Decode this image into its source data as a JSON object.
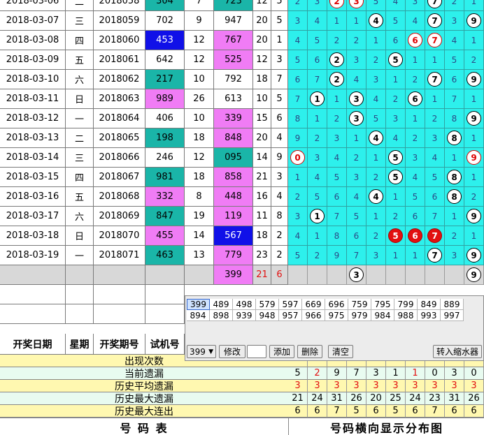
{
  "rows": [
    {
      "date": "2018-03-06",
      "weekday": "二",
      "issue": "2018058",
      "trial": "304",
      "trial_color": "teal",
      "c5": "7",
      "draw": "723",
      "draw_color": "teal",
      "c7": "12",
      "c8": "5"
    },
    {
      "date": "2018-03-07",
      "weekday": "三",
      "issue": "2018059",
      "trial": "702",
      "trial_color": "none",
      "c5": "9",
      "draw": "947",
      "draw_color": "none",
      "c7": "20",
      "c8": "5"
    },
    {
      "date": "2018-03-08",
      "weekday": "四",
      "issue": "2018060",
      "trial": "453",
      "trial_color": "blue",
      "c5": "12",
      "draw": "767",
      "draw_color": "pink",
      "c7": "20",
      "c8": "1"
    },
    {
      "date": "2018-03-09",
      "weekday": "五",
      "issue": "2018061",
      "trial": "642",
      "trial_color": "none",
      "c5": "12",
      "draw": "525",
      "draw_color": "pink",
      "c7": "12",
      "c8": "3"
    },
    {
      "date": "2018-03-10",
      "weekday": "六",
      "issue": "2018062",
      "trial": "217",
      "trial_color": "teal",
      "c5": "10",
      "draw": "792",
      "draw_color": "none",
      "c7": "18",
      "c8": "7"
    },
    {
      "date": "2018-03-11",
      "weekday": "日",
      "issue": "2018063",
      "trial": "989",
      "trial_color": "pink",
      "c5": "26",
      "draw": "613",
      "draw_color": "none",
      "c7": "10",
      "c8": "5"
    },
    {
      "date": "2018-03-12",
      "weekday": "一",
      "issue": "2018064",
      "trial": "406",
      "trial_color": "none",
      "c5": "10",
      "draw": "339",
      "draw_color": "pink",
      "c7": "15",
      "c8": "6"
    },
    {
      "date": "2018-03-13",
      "weekday": "二",
      "issue": "2018065",
      "trial": "198",
      "trial_color": "teal",
      "c5": "18",
      "draw": "848",
      "draw_color": "pink",
      "c7": "20",
      "c8": "4"
    },
    {
      "date": "2018-03-14",
      "weekday": "三",
      "issue": "2018066",
      "trial": "246",
      "trial_color": "none",
      "c5": "12",
      "draw": "095",
      "draw_color": "teal",
      "c7": "14",
      "c8": "9"
    },
    {
      "date": "2018-03-15",
      "weekday": "四",
      "issue": "2018067",
      "trial": "981",
      "trial_color": "teal",
      "c5": "18",
      "draw": "858",
      "draw_color": "pink",
      "c7": "21",
      "c8": "3"
    },
    {
      "date": "2018-03-16",
      "weekday": "五",
      "issue": "2018068",
      "trial": "332",
      "trial_color": "pink",
      "c5": "8",
      "draw": "448",
      "draw_color": "pink",
      "c7": "16",
      "c8": "4"
    },
    {
      "date": "2018-03-17",
      "weekday": "六",
      "issue": "2018069",
      "trial": "847",
      "trial_color": "teal",
      "c5": "19",
      "draw": "119",
      "draw_color": "pink",
      "c7": "11",
      "c8": "8"
    },
    {
      "date": "2018-03-18",
      "weekday": "日",
      "issue": "2018070",
      "trial": "455",
      "trial_color": "pink",
      "c5": "14",
      "draw": "567",
      "draw_color": "blue",
      "c7": "18",
      "c8": "2"
    },
    {
      "date": "2018-03-19",
      "weekday": "一",
      "issue": "2018071",
      "trial": "463",
      "trial_color": "teal",
      "c5": "13",
      "draw": "779",
      "draw_color": "pink",
      "c7": "23",
      "c8": "2"
    }
  ],
  "dist": [
    [
      "2",
      "3",
      {
        "v": "2",
        "s": "rw"
      },
      {
        "v": "3",
        "s": "rw"
      },
      "5",
      "4",
      "3",
      {
        "v": "7",
        "s": "w"
      },
      "2",
      "1"
    ],
    [
      "3",
      "4",
      "1",
      "1",
      {
        "v": "4",
        "s": "w"
      },
      "5",
      "4",
      {
        "v": "7",
        "s": "w"
      },
      "3",
      {
        "v": "9",
        "s": "w"
      }
    ],
    [
      "4",
      "5",
      "2",
      "2",
      "1",
      "6",
      {
        "v": "6",
        "s": "rw"
      },
      {
        "v": "7",
        "s": "rw"
      },
      "4",
      "1"
    ],
    [
      "5",
      "6",
      {
        "v": "2",
        "s": "w"
      },
      "3",
      "2",
      {
        "v": "5",
        "s": "w"
      },
      "1",
      "1",
      "5",
      "2"
    ],
    [
      "6",
      "7",
      {
        "v": "2",
        "s": "w"
      },
      "4",
      "3",
      "1",
      "2",
      {
        "v": "7",
        "s": "w"
      },
      "6",
      {
        "v": "9",
        "s": "w"
      }
    ],
    [
      "7",
      {
        "v": "1",
        "s": "w"
      },
      "1",
      {
        "v": "3",
        "s": "w"
      },
      "4",
      "2",
      {
        "v": "6",
        "s": "w"
      },
      "1",
      "7",
      "1"
    ],
    [
      "8",
      "1",
      "2",
      {
        "v": "3",
        "s": "w"
      },
      "5",
      "3",
      "1",
      "2",
      "8",
      {
        "v": "9",
        "s": "w"
      }
    ],
    [
      "9",
      "2",
      "3",
      "1",
      {
        "v": "4",
        "s": "w"
      },
      "4",
      "2",
      "3",
      {
        "v": "8",
        "s": "w"
      },
      "1"
    ],
    [
      {
        "v": "0",
        "s": "rw"
      },
      "3",
      "4",
      "2",
      "1",
      {
        "v": "5",
        "s": "w"
      },
      "3",
      "4",
      "1",
      {
        "v": "9",
        "s": "rw"
      }
    ],
    [
      "1",
      "4",
      "5",
      "3",
      "2",
      {
        "v": "5",
        "s": "w"
      },
      "4",
      "5",
      {
        "v": "8",
        "s": "w"
      },
      "1"
    ],
    [
      "2",
      "5",
      "6",
      "4",
      {
        "v": "4",
        "s": "w"
      },
      "1",
      "5",
      "6",
      {
        "v": "8",
        "s": "w"
      },
      "2"
    ],
    [
      "3",
      {
        "v": "1",
        "s": "w"
      },
      "7",
      "5",
      "1",
      "2",
      "6",
      "7",
      "1",
      {
        "v": "9",
        "s": "w"
      }
    ],
    [
      "4",
      "1",
      "8",
      "6",
      "2",
      {
        "v": "5",
        "s": "r"
      },
      {
        "v": "6",
        "s": "r"
      },
      {
        "v": "7",
        "s": "r"
      },
      "2",
      "1"
    ],
    [
      "5",
      "2",
      "9",
      "7",
      "3",
      "1",
      "1",
      {
        "v": "7",
        "s": "w"
      },
      "3",
      {
        "v": "9",
        "s": "w"
      }
    ]
  ],
  "extra_row": {
    "draw": "399",
    "c7": "21",
    "c8": "6",
    "balls": [
      {
        "col": 3,
        "v": "3"
      },
      {
        "col": 9,
        "v": "9"
      }
    ]
  },
  "headers": {
    "date": "开奖日期",
    "weekday": "星期",
    "issue": "开奖期号",
    "trial": "试机号"
  },
  "candidates": {
    "row1": [
      "399",
      "489",
      "498",
      "579",
      "597",
      "669",
      "696",
      "759",
      "795",
      "799",
      "849",
      "889"
    ],
    "row2": [
      "894",
      "898",
      "939",
      "948",
      "957",
      "966",
      "975",
      "979",
      "984",
      "988",
      "993",
      "997"
    ],
    "selected": "399"
  },
  "controls": {
    "select_value": "399",
    "edit": "修改",
    "add": "添加",
    "delete": "删除",
    "clear": "清空",
    "filter": "转入缩水器"
  },
  "stats": [
    {
      "label": "出现次数",
      "values": [
        "",
        "",
        "",
        "",
        "",
        "",
        "",
        "",
        "",
        ""
      ]
    },
    {
      "label": "当前遗漏",
      "values": [
        "5",
        "2",
        "9",
        "7",
        "3",
        "1",
        "1",
        "0",
        "3",
        "0"
      ],
      "red": [
        1,
        6
      ]
    },
    {
      "label": "历史平均遗漏",
      "values": [
        "3",
        "3",
        "3",
        "3",
        "3",
        "3",
        "3",
        "3",
        "3",
        "3"
      ],
      "red": [
        0,
        1,
        2,
        3,
        4,
        5,
        6,
        7,
        8,
        9
      ]
    },
    {
      "label": "历史最大遗漏",
      "values": [
        "21",
        "24",
        "31",
        "26",
        "20",
        "25",
        "24",
        "23",
        "31",
        "26"
      ]
    },
    {
      "label": "历史最大连出",
      "values": [
        "6",
        "6",
        "7",
        "5",
        "6",
        "5",
        "6",
        "7",
        "6",
        "6"
      ]
    }
  ],
  "footer": {
    "left": "号  码  表",
    "right": "号码横向显示分布图"
  },
  "colors": {
    "cyan": "#2df0ec",
    "teal": "#1ab5a8",
    "pink": "#f07cf5",
    "blue": "#1010e8",
    "red": "#e21010"
  }
}
